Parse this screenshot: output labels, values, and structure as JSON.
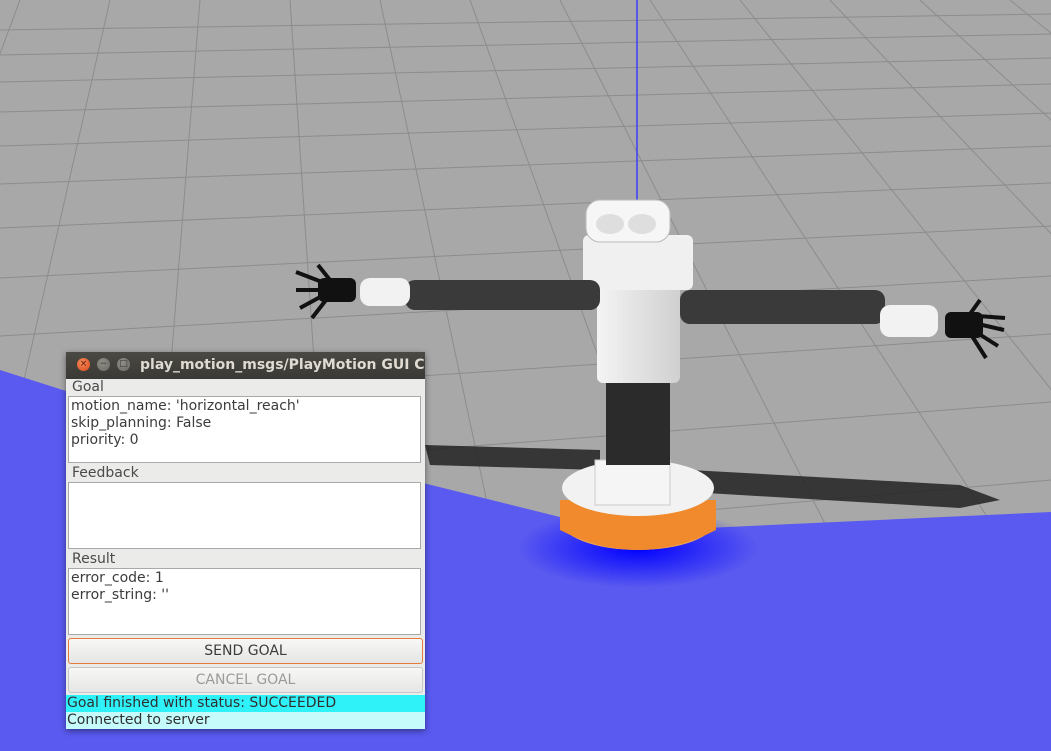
{
  "window": {
    "title": "play_motion_msgs/PlayMotion GUI Cli",
    "close_glyph": "×",
    "minimize_glyph": "−",
    "maximize_glyph": "□"
  },
  "goal": {
    "label": "Goal",
    "lines": [
      "motion_name: 'horizontal_reach'",
      "skip_planning: False",
      "priority: 0"
    ]
  },
  "feedback": {
    "label": "Feedback",
    "lines": []
  },
  "result": {
    "label": "Result",
    "lines": [
      "error_code: 1",
      "error_string: ''"
    ]
  },
  "buttons": {
    "send": "SEND GOAL",
    "cancel": "CANCEL GOAL"
  },
  "status": {
    "finished": "Goal finished with status: SUCCEEDED",
    "connection": "Connected to server",
    "finished_color": "#2ff2f8",
    "connection_color": "#c6fbfc"
  },
  "scene": {
    "floor_color": "#a8a8a8",
    "grid_color": "#8c8c8c",
    "ground_color": "#5a5af0",
    "orange_color": "#f08a2c"
  }
}
